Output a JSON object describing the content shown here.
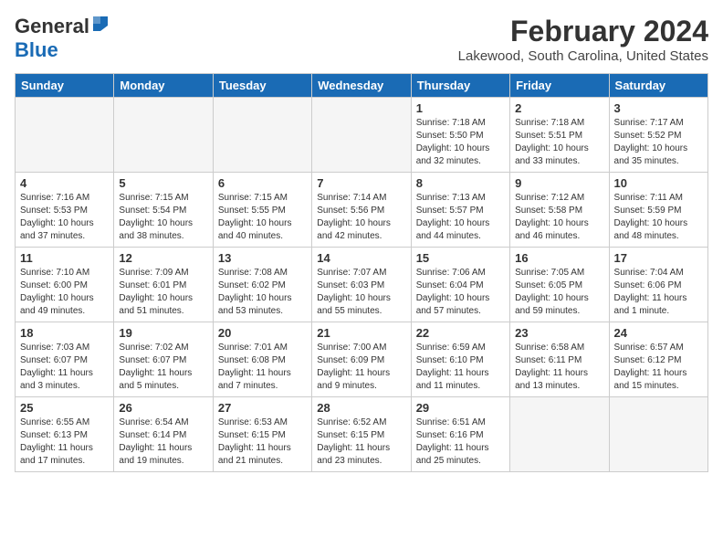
{
  "header": {
    "logo_general": "General",
    "logo_blue": "Blue",
    "title": "February 2024",
    "subtitle": "Lakewood, South Carolina, United States"
  },
  "calendar": {
    "days_of_week": [
      "Sunday",
      "Monday",
      "Tuesday",
      "Wednesday",
      "Thursday",
      "Friday",
      "Saturday"
    ],
    "weeks": [
      [
        {
          "day": "",
          "info": ""
        },
        {
          "day": "",
          "info": ""
        },
        {
          "day": "",
          "info": ""
        },
        {
          "day": "",
          "info": ""
        },
        {
          "day": "1",
          "info": "Sunrise: 7:18 AM\nSunset: 5:50 PM\nDaylight: 10 hours\nand 32 minutes."
        },
        {
          "day": "2",
          "info": "Sunrise: 7:18 AM\nSunset: 5:51 PM\nDaylight: 10 hours\nand 33 minutes."
        },
        {
          "day": "3",
          "info": "Sunrise: 7:17 AM\nSunset: 5:52 PM\nDaylight: 10 hours\nand 35 minutes."
        }
      ],
      [
        {
          "day": "4",
          "info": "Sunrise: 7:16 AM\nSunset: 5:53 PM\nDaylight: 10 hours\nand 37 minutes."
        },
        {
          "day": "5",
          "info": "Sunrise: 7:15 AM\nSunset: 5:54 PM\nDaylight: 10 hours\nand 38 minutes."
        },
        {
          "day": "6",
          "info": "Sunrise: 7:15 AM\nSunset: 5:55 PM\nDaylight: 10 hours\nand 40 minutes."
        },
        {
          "day": "7",
          "info": "Sunrise: 7:14 AM\nSunset: 5:56 PM\nDaylight: 10 hours\nand 42 minutes."
        },
        {
          "day": "8",
          "info": "Sunrise: 7:13 AM\nSunset: 5:57 PM\nDaylight: 10 hours\nand 44 minutes."
        },
        {
          "day": "9",
          "info": "Sunrise: 7:12 AM\nSunset: 5:58 PM\nDaylight: 10 hours\nand 46 minutes."
        },
        {
          "day": "10",
          "info": "Sunrise: 7:11 AM\nSunset: 5:59 PM\nDaylight: 10 hours\nand 48 minutes."
        }
      ],
      [
        {
          "day": "11",
          "info": "Sunrise: 7:10 AM\nSunset: 6:00 PM\nDaylight: 10 hours\nand 49 minutes."
        },
        {
          "day": "12",
          "info": "Sunrise: 7:09 AM\nSunset: 6:01 PM\nDaylight: 10 hours\nand 51 minutes."
        },
        {
          "day": "13",
          "info": "Sunrise: 7:08 AM\nSunset: 6:02 PM\nDaylight: 10 hours\nand 53 minutes."
        },
        {
          "day": "14",
          "info": "Sunrise: 7:07 AM\nSunset: 6:03 PM\nDaylight: 10 hours\nand 55 minutes."
        },
        {
          "day": "15",
          "info": "Sunrise: 7:06 AM\nSunset: 6:04 PM\nDaylight: 10 hours\nand 57 minutes."
        },
        {
          "day": "16",
          "info": "Sunrise: 7:05 AM\nSunset: 6:05 PM\nDaylight: 10 hours\nand 59 minutes."
        },
        {
          "day": "17",
          "info": "Sunrise: 7:04 AM\nSunset: 6:06 PM\nDaylight: 11 hours\nand 1 minute."
        }
      ],
      [
        {
          "day": "18",
          "info": "Sunrise: 7:03 AM\nSunset: 6:07 PM\nDaylight: 11 hours\nand 3 minutes."
        },
        {
          "day": "19",
          "info": "Sunrise: 7:02 AM\nSunset: 6:07 PM\nDaylight: 11 hours\nand 5 minutes."
        },
        {
          "day": "20",
          "info": "Sunrise: 7:01 AM\nSunset: 6:08 PM\nDaylight: 11 hours\nand 7 minutes."
        },
        {
          "day": "21",
          "info": "Sunrise: 7:00 AM\nSunset: 6:09 PM\nDaylight: 11 hours\nand 9 minutes."
        },
        {
          "day": "22",
          "info": "Sunrise: 6:59 AM\nSunset: 6:10 PM\nDaylight: 11 hours\nand 11 minutes."
        },
        {
          "day": "23",
          "info": "Sunrise: 6:58 AM\nSunset: 6:11 PM\nDaylight: 11 hours\nand 13 minutes."
        },
        {
          "day": "24",
          "info": "Sunrise: 6:57 AM\nSunset: 6:12 PM\nDaylight: 11 hours\nand 15 minutes."
        }
      ],
      [
        {
          "day": "25",
          "info": "Sunrise: 6:55 AM\nSunset: 6:13 PM\nDaylight: 11 hours\nand 17 minutes."
        },
        {
          "day": "26",
          "info": "Sunrise: 6:54 AM\nSunset: 6:14 PM\nDaylight: 11 hours\nand 19 minutes."
        },
        {
          "day": "27",
          "info": "Sunrise: 6:53 AM\nSunset: 6:15 PM\nDaylight: 11 hours\nand 21 minutes."
        },
        {
          "day": "28",
          "info": "Sunrise: 6:52 AM\nSunset: 6:15 PM\nDaylight: 11 hours\nand 23 minutes."
        },
        {
          "day": "29",
          "info": "Sunrise: 6:51 AM\nSunset: 6:16 PM\nDaylight: 11 hours\nand 25 minutes."
        },
        {
          "day": "",
          "info": ""
        },
        {
          "day": "",
          "info": ""
        }
      ]
    ]
  }
}
